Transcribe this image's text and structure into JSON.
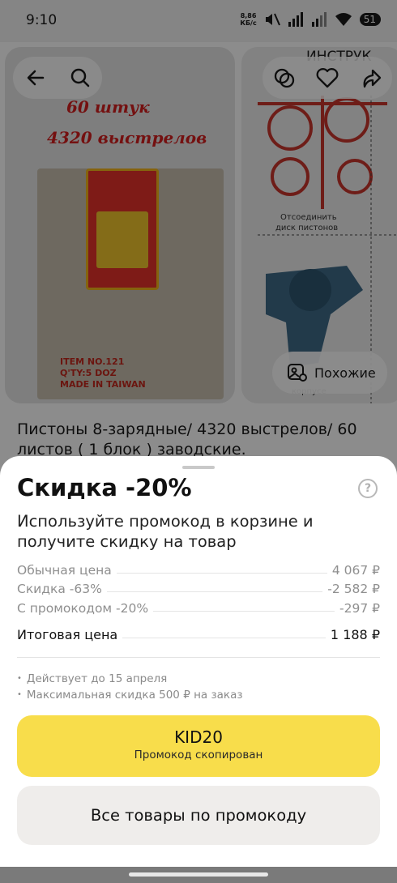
{
  "status_bar": {
    "time": "9:10",
    "speed_value": "8,86",
    "speed_unit": "КБ/с",
    "battery": "51"
  },
  "product": {
    "image_text_line1": "60 штук",
    "image_text_line2": "4320 выстрелов",
    "image_box_label": "ITEM NO.121\nQ'TY:5 DOZ\nMADE IN TAIWAN",
    "second_image_caption1": "Отсоединить",
    "second_image_caption2": "диск пистонов",
    "second_image_caption3": "корпусе",
    "second_image_top": "ИНСТРУК",
    "similar_label": "Похожие",
    "title": "Пистоны 8-зарядные/ 4320 выстрелов/ 60 листов ( 1 блок ) заводские."
  },
  "sheet": {
    "title": "Скидка -20%",
    "help_glyph": "?",
    "subtitle": "Используйте промокод в корзине и получите скидку на товар",
    "price_rows": [
      {
        "label": "Обычная цена",
        "value": "4 067 ₽"
      },
      {
        "label": "Скидка -63%",
        "value": "-2 582 ₽"
      },
      {
        "label": "С промокодом -20%",
        "value": "-297 ₽"
      }
    ],
    "total": {
      "label": "Итоговая цена",
      "value": "1 188 ₽"
    },
    "notes": [
      "Действует до 15 апреля",
      "Максимальная скидка 500 ₽ на заказ"
    ],
    "promo_code": "KID20",
    "promo_status": "Промокод скопирован",
    "all_products_label": "Все товары по промокоду"
  },
  "colors": {
    "promo_button": "#f8dd4b",
    "secondary_button": "#efedeb",
    "image_text_red": "#d31e1e"
  }
}
